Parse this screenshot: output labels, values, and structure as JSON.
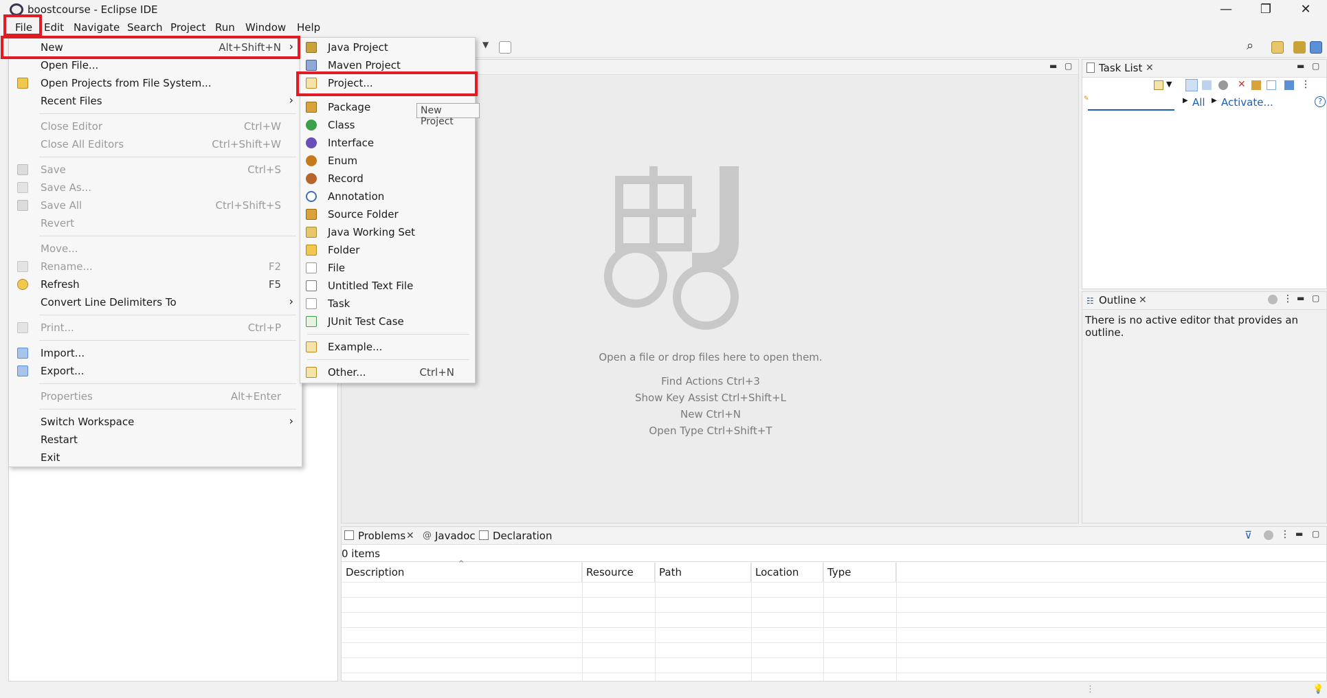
{
  "window": {
    "title": "boostcourse - Eclipse IDE",
    "minimize": "—",
    "restore": "❐",
    "close": "✕"
  },
  "menubar": [
    "File",
    "Edit",
    "Navigate",
    "Search",
    "Project",
    "Run",
    "Window",
    "Help"
  ],
  "file_menu": {
    "items": [
      {
        "label": "New",
        "accel": "Alt+Shift+N",
        "submenu": true,
        "enabled": true,
        "icon": ""
      },
      {
        "label": "Open File...",
        "accel": "",
        "enabled": true,
        "icon": ""
      },
      {
        "label": "Open Projects from File System...",
        "accel": "",
        "enabled": true,
        "icon": "folder-icon"
      },
      {
        "label": "Recent Files",
        "accel": "",
        "submenu": true,
        "enabled": true,
        "icon": ""
      },
      {
        "label": "Close Editor",
        "accel": "Ctrl+W",
        "enabled": false,
        "icon": ""
      },
      {
        "label": "Close All Editors",
        "accel": "Ctrl+Shift+W",
        "enabled": false,
        "icon": ""
      },
      {
        "label": "Save",
        "accel": "Ctrl+S",
        "enabled": false,
        "icon": "save-icon"
      },
      {
        "label": "Save As...",
        "accel": "",
        "enabled": false,
        "icon": "save-as-icon"
      },
      {
        "label": "Save All",
        "accel": "Ctrl+Shift+S",
        "enabled": false,
        "icon": "save-all-icon"
      },
      {
        "label": "Revert",
        "accel": "",
        "enabled": false,
        "icon": ""
      },
      {
        "label": "Move...",
        "accel": "",
        "enabled": false,
        "icon": ""
      },
      {
        "label": "Rename...",
        "accel": "F2",
        "enabled": false,
        "icon": "rename-icon"
      },
      {
        "label": "Refresh",
        "accel": "F5",
        "enabled": true,
        "icon": "refresh-icon"
      },
      {
        "label": "Convert Line Delimiters To",
        "accel": "",
        "submenu": true,
        "enabled": true,
        "icon": ""
      },
      {
        "label": "Print...",
        "accel": "Ctrl+P",
        "enabled": false,
        "icon": "print-icon"
      },
      {
        "label": "Import...",
        "accel": "",
        "enabled": true,
        "icon": "import-icon"
      },
      {
        "label": "Export...",
        "accel": "",
        "enabled": true,
        "icon": "export-icon"
      },
      {
        "label": "Properties",
        "accel": "Alt+Enter",
        "enabled": false,
        "icon": ""
      },
      {
        "label": "Switch Workspace",
        "accel": "",
        "submenu": true,
        "enabled": true,
        "icon": ""
      },
      {
        "label": "Restart",
        "accel": "",
        "enabled": true,
        "icon": ""
      },
      {
        "label": "Exit",
        "accel": "",
        "enabled": true,
        "icon": ""
      }
    ]
  },
  "new_menu": {
    "items": [
      {
        "label": "Java Project",
        "accel": "",
        "icon": "java-project-icon"
      },
      {
        "label": "Maven Project",
        "accel": "",
        "icon": "maven-project-icon"
      },
      {
        "label": "Project...",
        "accel": "",
        "icon": "project-icon"
      },
      {
        "label": "Package",
        "accel": "",
        "icon": "package-icon"
      },
      {
        "label": "Class",
        "accel": "",
        "icon": "class-icon"
      },
      {
        "label": "Interface",
        "accel": "",
        "icon": "interface-icon"
      },
      {
        "label": "Enum",
        "accel": "",
        "icon": "enum-icon"
      },
      {
        "label": "Record",
        "accel": "",
        "icon": "record-icon"
      },
      {
        "label": "Annotation",
        "accel": "",
        "icon": "annotation-icon"
      },
      {
        "label": "Source Folder",
        "accel": "",
        "icon": "source-folder-icon"
      },
      {
        "label": "Java Working Set",
        "accel": "",
        "icon": "working-set-icon"
      },
      {
        "label": "Folder",
        "accel": "",
        "icon": "folder-icon"
      },
      {
        "label": "File",
        "accel": "",
        "icon": "file-icon"
      },
      {
        "label": "Untitled Text File",
        "accel": "",
        "icon": "text-file-icon"
      },
      {
        "label": "Task",
        "accel": "",
        "icon": "task-icon"
      },
      {
        "label": "JUnit Test Case",
        "accel": "",
        "icon": "junit-icon"
      },
      {
        "label": "Example...",
        "accel": "",
        "icon": "example-icon"
      },
      {
        "label": "Other...",
        "accel": "Ctrl+N",
        "icon": "other-icon"
      }
    ],
    "tooltip": "New Project"
  },
  "editor": {
    "drop_hint": "Open a file or drop files here to open them.",
    "shortcuts": [
      "Find Actions Ctrl+3",
      "Show Key Assist Ctrl+Shift+L",
      "New Ctrl+N",
      "Open Type Ctrl+Shift+T"
    ]
  },
  "task_list": {
    "tab": "Task List",
    "filter_all": "All",
    "activate": "Activate..."
  },
  "outline": {
    "tab": "Outline",
    "message": "There is no active editor that provides an outline."
  },
  "bottom": {
    "tabs": [
      "Problems",
      "Javadoc",
      "Declaration"
    ],
    "count": "0 items",
    "columns": [
      "Description",
      "Resource",
      "Path",
      "Location",
      "Type"
    ]
  },
  "colors": {
    "highlight": "#e01b24",
    "link": "#1a5fb4"
  }
}
